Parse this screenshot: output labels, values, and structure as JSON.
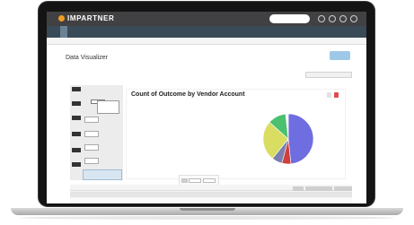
{
  "brand": {
    "name": "IMPARTNER"
  },
  "pageTitle": "Data Visualizer",
  "chart": {
    "title": "Count of Outcome by Vendor Account"
  },
  "chart_data": {
    "type": "pie",
    "categories": [
      "",
      "",
      "",
      "",
      "",
      ""
    ],
    "values": [
      48.3,
      5.8,
      6.7,
      25.8,
      11.7,
      1.7
    ]
  },
  "colors": {
    "slice1": "#6f6ee0",
    "slice2": "#cf3f3f",
    "slice3": "#7a7fb1",
    "slice4": "#d9dd62",
    "slice5": "#4bc06f",
    "slice6": "#f7f7f7"
  }
}
